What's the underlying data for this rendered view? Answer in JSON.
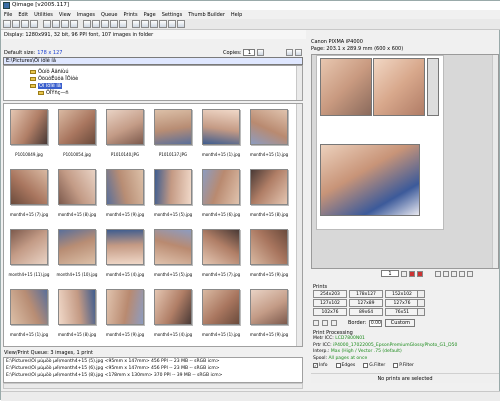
{
  "window": {
    "title": "Qimage [v2005.117]"
  },
  "menu": [
    "File",
    "Edit",
    "Utilities",
    "View",
    "Images",
    "Queue",
    "Prints",
    "Page",
    "Settings",
    "Thumb Builder",
    "Help"
  ],
  "display_info": "Display: 1280x991, 32 bit, 96 PPI font, 107 images in folder",
  "default_size": {
    "label": "Default size:",
    "value": "178 x 127"
  },
  "copies": {
    "label": "Copies:",
    "value": "1"
  },
  "path": "E:\\Pictures\\Ôí íôîê íâ",
  "tree": [
    {
      "label": "Ôúíô Ââñíùú",
      "selected": false
    },
    {
      "label": "ÔöüôÊüôä ÎÔíôè",
      "selected": false
    },
    {
      "label": "Ôí íôîê íâ",
      "selected": true
    },
    {
      "label": "ÔÎÝñç—ñ",
      "selected": false
    }
  ],
  "thumbnails": [
    {
      "caption": "P1010049.jpg"
    },
    {
      "caption": "P1010054.jpg"
    },
    {
      "caption": "P1010140.JPG"
    },
    {
      "caption": "P1010137.JPG"
    },
    {
      "caption": "month4+15 (1).jpg"
    },
    {
      "caption": "month4+15 (1).jpg"
    },
    {
      "caption": "month4+15 (7).jpg"
    },
    {
      "caption": "month4+15 (8).jpg"
    },
    {
      "caption": "month4+15 (9).jpg"
    },
    {
      "caption": "month4+15 (5).jpg"
    },
    {
      "caption": "month4+15 (6).jpg"
    },
    {
      "caption": "month4+15 (8).jpg"
    },
    {
      "caption": "month4+15 (11).jpg"
    },
    {
      "caption": "month4+15 (10).jpg"
    },
    {
      "caption": "month4+15 (4).jpg"
    },
    {
      "caption": "month4+15 (5).jpg"
    },
    {
      "caption": "month4+15 (7).jpg"
    },
    {
      "caption": "month4+15 (9).jpg"
    },
    {
      "caption": "month4+15 (1).jpg"
    },
    {
      "caption": "month4+15 (8).jpg"
    },
    {
      "caption": "month4+15 (9).jpg"
    },
    {
      "caption": "month4+15 (4).jpg"
    },
    {
      "caption": "month4+15 (1).jpg"
    },
    {
      "caption": "month4+15 (9).jpg"
    }
  ],
  "queue": {
    "title": "View/Print Queue: 3 images, 1 print",
    "rows": [
      "E:\\Pictures\\Ôí µùµöò µé\\month4+15 (5).jpg  <95mm x 147mm>  456 PPI -- 23 MB -- sRGB icm>",
      "E:\\Pictures\\Ôí µùµöò µé\\month4+15 (6).jpg  <95mm x 147mm>  456 PPI -- 23 MB -- sRGB icm>",
      "E:\\Pictures\\Ôí µùµöò µé\\month4+15 (8).jpg  <178mm x 130mm>  370 PPI -- 39 MB -- sRGB icm>"
    ]
  },
  "printer": {
    "name": "Canon PIXMA iP4000",
    "page": "Page: 203.1 x 289.9 mm   (600 x 600)"
  },
  "preview_page_select": "1",
  "prints": {
    "label": "Prints",
    "sizes": [
      "254x203",
      "178x127",
      "152x102",
      "127x102",
      "127x89",
      "127x76",
      "102x76",
      "89x64",
      "76x51"
    ]
  },
  "border": {
    "label": "Border:",
    "value": "0.00",
    "custom_label": "Custom"
  },
  "print_processing": {
    "label": "Print Processing",
    "metr_icc_label": "Metr ICC:",
    "metr_icc": "LCD7800N01",
    "prtr_icc_label": "Prtr ICC:",
    "prtr_icc": "iP4000_17022005_EpsonPremiumGlossyPhoto_G1_D50",
    "interp_label": "Interp.:",
    "interp": "Max (High / Vector   .75 (default)",
    "spool_label": "Spool:",
    "spool": "All pages at once",
    "checks": [
      {
        "label": "Info",
        "checked": true
      },
      {
        "label": "Edges",
        "checked": false
      },
      {
        "label": "G.Filter",
        "checked": false
      },
      {
        "label": "P.Filter",
        "checked": false
      }
    ]
  },
  "status": {
    "no_prints": "No prints are selected"
  }
}
